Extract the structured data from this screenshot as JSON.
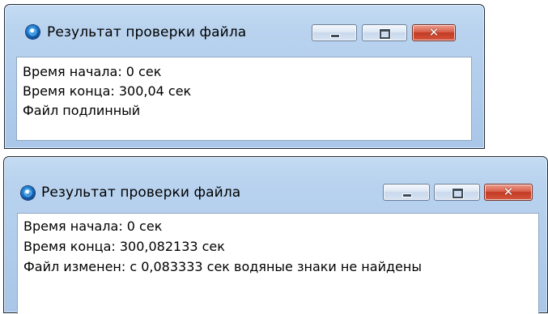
{
  "windows": [
    {
      "title": "Результат проверки файла",
      "icon": "app-globe-icon",
      "buttons": {
        "minimize": "minimize",
        "maximize": "maximize",
        "close": "close"
      },
      "lines": [
        "Время начала: 0 сек",
        "Время конца: 300,04 сек",
        "Файл подлинный"
      ]
    },
    {
      "title": "Результат проверки файла",
      "icon": "app-globe-icon",
      "buttons": {
        "minimize": "minimize",
        "maximize": "maximize",
        "close": "close"
      },
      "lines": [
        "Время начала: 0 сек",
        "Время конца: 300,082133 сек",
        "Файл изменен: с 0,083333 сек водяные знаки не найдены"
      ]
    }
  ],
  "colors": {
    "frame": "#b9d3ef",
    "close_button": "#c23b24",
    "client": "#ffffff"
  }
}
